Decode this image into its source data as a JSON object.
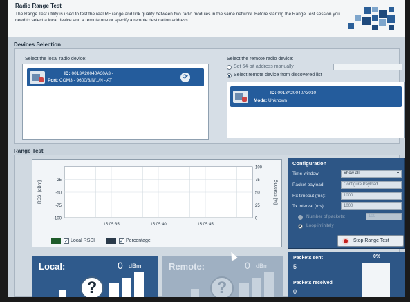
{
  "header": {
    "title": "Radio Range Test",
    "description": "The Range Test utility is used to test the real RF range and link quality between two radio modules in the same network. Before starting the Range Test session you need to select a local device and a remote one or specify a remote destination address."
  },
  "devices_section": {
    "title": "Devices Selection",
    "local_label": "Select the local radio device:",
    "local_device": {
      "id_label": "ID:",
      "id_value": "0013A20040A30A3 -",
      "port_label": "Port:",
      "port_value": "COM3 - 9600/8/N/1/N - AT",
      "icon": "radio-module-icon"
    },
    "remote_label": "Select the remote radio device:",
    "remote_option_1": "Set 64-bit address manually",
    "remote_option_2": "Select remote device from discovered list",
    "remote_device": {
      "id_label": "ID:",
      "id_value": "0013A20040A3010 -",
      "mode_label": "Mode:",
      "mode_value": "Unknown",
      "icon": "radio-module-icon"
    }
  },
  "range_test": {
    "title": "Range Test",
    "chart_data": {
      "type": "line",
      "ylabel": "RSSI [dBm]",
      "y2label": "Success [%]",
      "y_ticks": [
        "-25",
        "-50",
        "-75",
        "-100"
      ],
      "y2_ticks": [
        "100",
        "75",
        "50",
        "25",
        "0"
      ],
      "x_ticks": [
        "15:05:35",
        "15:05:40",
        "15:05:45"
      ],
      "ylim": [
        -100,
        0
      ],
      "y2lim": [
        0,
        100
      ],
      "grid": true,
      "series": [
        {
          "name": "Local RSSI",
          "values": [],
          "color": "#1e5b2a"
        },
        {
          "name": "Percentage",
          "values": [],
          "color": "#2a3a4a"
        }
      ]
    },
    "legend_local": "Local RSSI",
    "legend_percentage": "Percentage"
  },
  "configuration": {
    "title": "Configuration",
    "time_window_label": "Time window:",
    "time_window_value": "Show all",
    "packet_payload_label": "Packet payload:",
    "packet_payload_value": "Configure Payload",
    "rx_timeout_label": "Rx timeout (ms):",
    "rx_timeout_value": "1000",
    "tx_interval_label": "Tx interval (ms):",
    "tx_interval_value": "1000",
    "num_packets_label": "Number of packets:",
    "num_packets_value": "100",
    "loop_label": "Loop infinitely",
    "stop_label": "Stop Range Test"
  },
  "signal": {
    "local_label": "Local:",
    "local_value": "0",
    "local_unit": "dBm",
    "remote_label": "Remote:",
    "remote_value": "0",
    "remote_unit": "dBm",
    "qmark": "?"
  },
  "stats": {
    "sent_label": "Packets sent",
    "sent_value": "5",
    "received_label": "Packets received",
    "received_value": "0",
    "percent_label": "0%"
  },
  "colors": {
    "accent": "#245c9c",
    "config_bg": "#2d5686",
    "stop_red": "#c2201d"
  }
}
